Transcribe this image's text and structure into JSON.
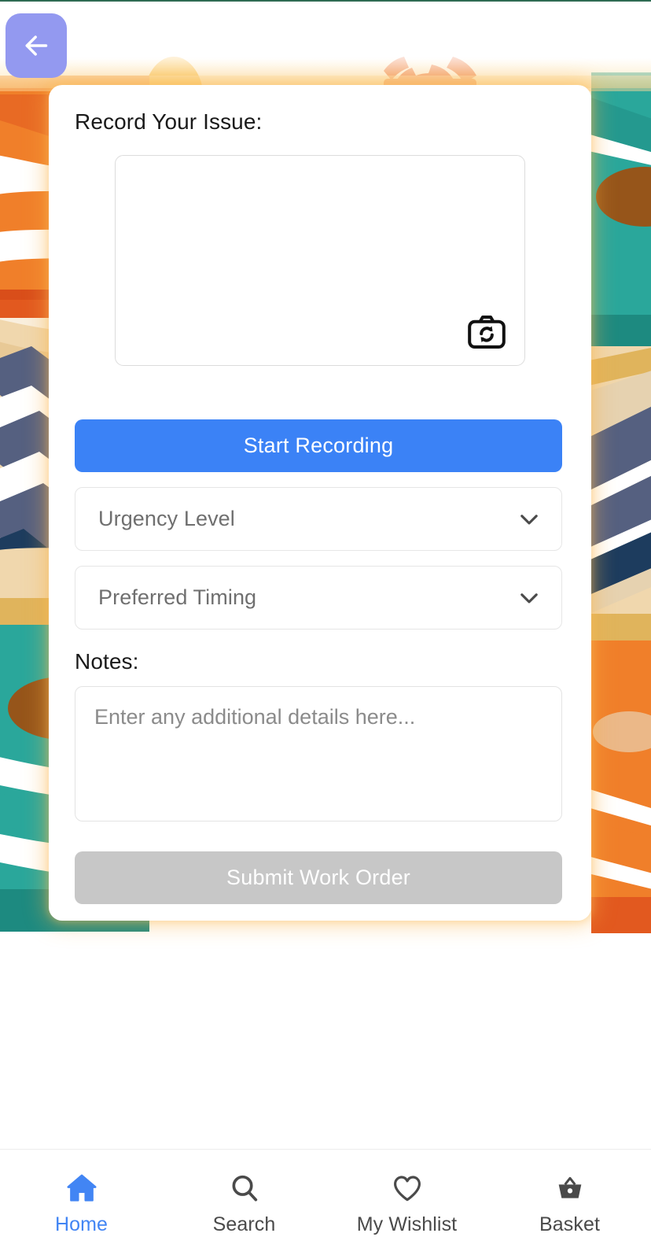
{
  "header": {
    "back_button_label": "Back",
    "back_icon": "arrow-left-icon",
    "back_button_color": "#9399f0"
  },
  "card": {
    "record_section_label": "Record Your Issue:",
    "preview": {
      "camera_flip_icon": "camera-flip-icon",
      "content": ""
    },
    "start_recording_label": "Start Recording",
    "start_recording_color": "#3b82f6",
    "selects": [
      {
        "name": "urgency-level",
        "value": "Urgency Level",
        "chevron_icon": "chevron-down-icon"
      },
      {
        "name": "preferred-timing",
        "value": "Preferred Timing",
        "chevron_icon": "chevron-down-icon"
      }
    ],
    "notes_label": "Notes:",
    "notes_placeholder": "Enter any additional details here...",
    "notes_value": "",
    "submit_label": "Submit Work Order",
    "submit_color": "#c7c7c7",
    "submit_disabled": true
  },
  "bottom_nav": {
    "active_color": "#4285f4",
    "inactive_color": "#4a4a4a",
    "items": [
      {
        "label": "Home",
        "icon": "home-icon",
        "active": true
      },
      {
        "label": "Search",
        "icon": "search-icon",
        "active": false
      },
      {
        "label": "My Wishlist",
        "icon": "heart-icon",
        "active": false
      },
      {
        "label": "Basket",
        "icon": "basket-icon",
        "active": false
      }
    ]
  },
  "background": {
    "colors": {
      "orange": "#f07f2a",
      "orange_dark": "#e2591f",
      "yellow": "#f9b42a",
      "teal": "#2aa79b",
      "teal_dark": "#1d8a80",
      "beige": "#f0d7ad",
      "tan": "#e0b45c",
      "navy": "#556080",
      "navy_dark": "#1d3c5e",
      "brown": "#96551a",
      "glow": "#fab246"
    }
  }
}
